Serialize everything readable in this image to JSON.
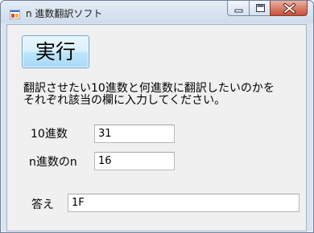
{
  "window": {
    "title": "n 進数翻訳ソフト"
  },
  "toolbar": {
    "run_label": "実行"
  },
  "instructions": {
    "line1": "翻訳させたい10進数と何進数に翻訳したいのかを",
    "line2": "それぞれ該当の欄に入力してください。"
  },
  "form": {
    "decimal": {
      "label": "10進数",
      "value": "31"
    },
    "base": {
      "label": "n進数のn",
      "value": "16"
    },
    "answer": {
      "label": "答え",
      "value": "1F"
    }
  },
  "colors": {
    "close_button": "#c7503a",
    "button_border": "#5fa5d8",
    "client_background": "#f0f0f0",
    "frame": "#d9e4f1"
  }
}
